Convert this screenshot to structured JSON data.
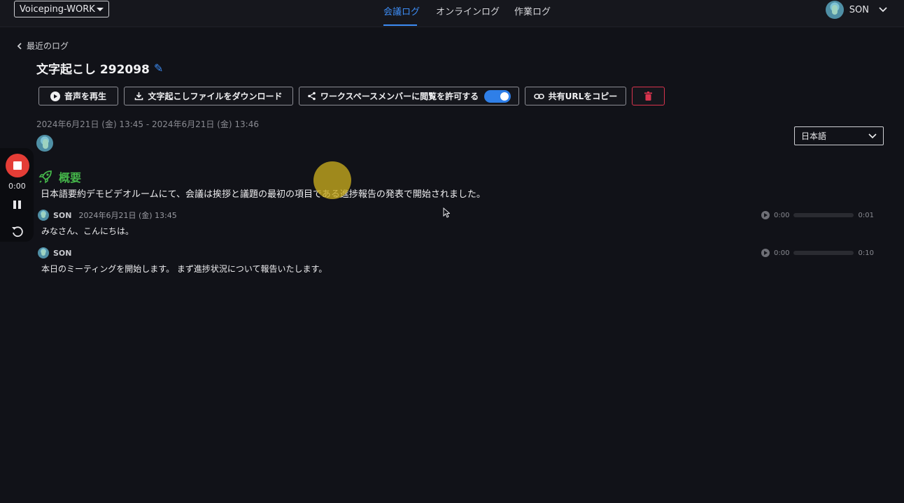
{
  "header": {
    "workspace": "Voiceping-WORK",
    "nav": [
      "会議ログ",
      "オンラインログ",
      "作業ログ"
    ],
    "active_nav": "会議ログ",
    "user_name": "SON"
  },
  "page": {
    "back_label": "最近のログ",
    "title": "文字起こし 292098",
    "date_range": "2024年6月21日 (金) 13:45 - 2024年6月21日 (金) 13:46",
    "language": "日本語"
  },
  "actions": {
    "play_audio": "音声を再生",
    "download": "文字起こしファイルをダウンロード",
    "allow_members": "ワークスペースメンバーに閲覧を許可する",
    "allow_members_enabled": true,
    "copy_url": "共有URLをコピー"
  },
  "recorder": {
    "time": "0:00"
  },
  "summary": {
    "heading": "概要",
    "text": "日本語要約デモビデオルームにて、会議は挨拶と議題の最初の項目である進捗報告の発表で開始されました。"
  },
  "utterances": [
    {
      "speaker": "SON",
      "timestamp": "2024年6月21日 (金) 13:45",
      "text": "みなさん、こんにちは。",
      "player_start": "0:00",
      "player_end": "0:01"
    },
    {
      "speaker": "SON",
      "timestamp": "",
      "text": "本日のミーティングを開始します。 まず進捗状況について報告いたします。",
      "player_start": "0:00",
      "player_end": "0:10"
    }
  ],
  "colors": {
    "accent": "#3d8df5",
    "summary_green": "#45b64a",
    "record_red": "#e43d36",
    "danger": "#d9344e"
  }
}
